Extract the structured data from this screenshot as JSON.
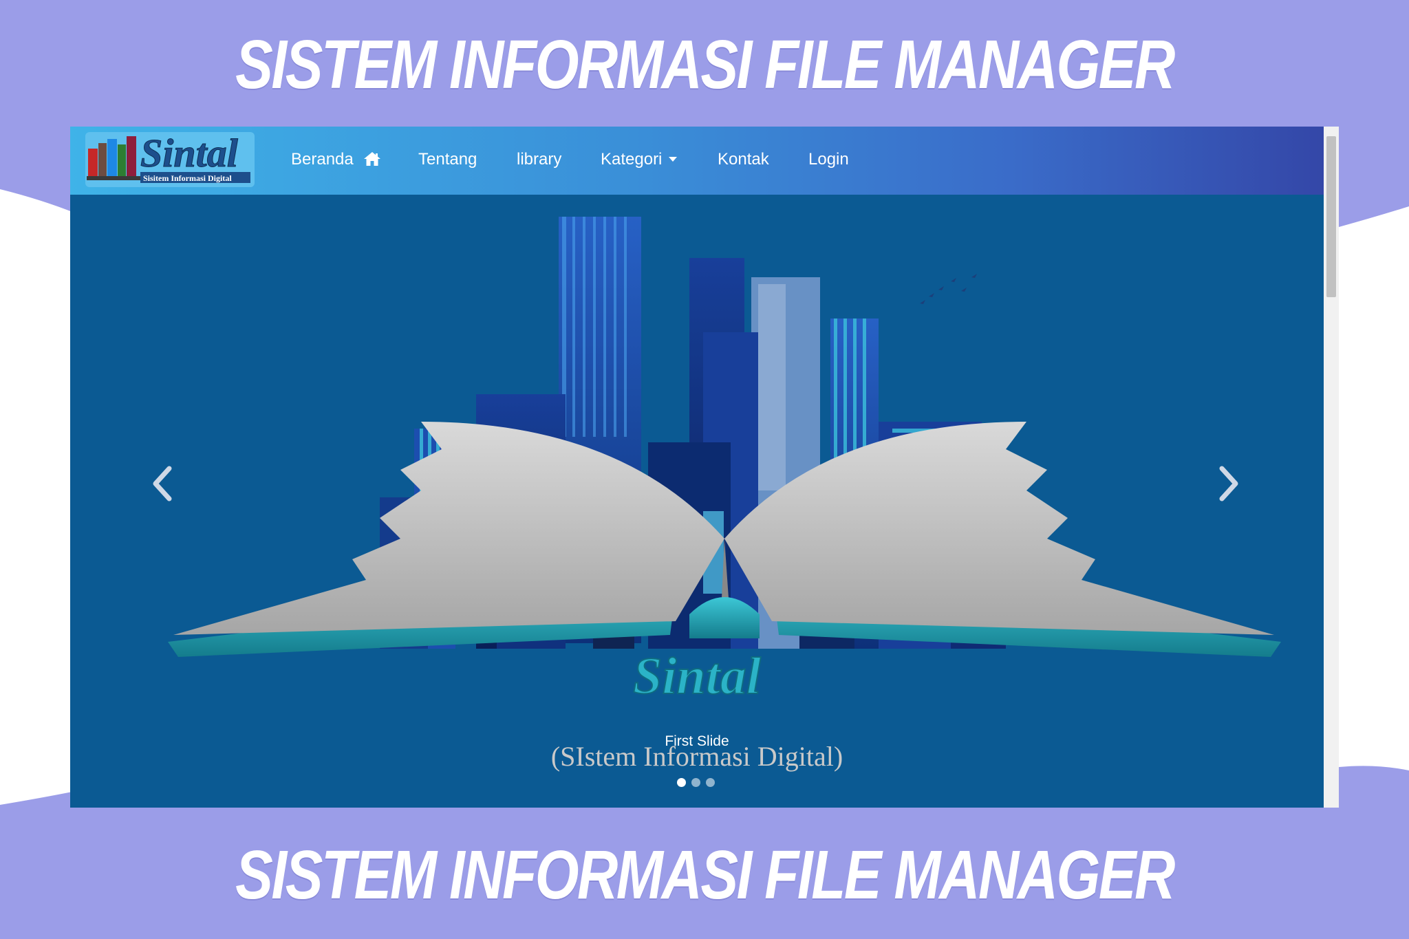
{
  "banner": {
    "title_top": "SISTEM INFORMASI FILE MANAGER",
    "title_bottom": "SISTEM INFORMASI FILE MANAGER"
  },
  "logo": {
    "name": "Sintal",
    "tagline": "Sisitem Informasi Digital"
  },
  "nav": {
    "items": [
      {
        "label": "Beranda",
        "icon": "home-icon"
      },
      {
        "label": "Tentang"
      },
      {
        "label": "library"
      },
      {
        "label": "Kategori",
        "icon": "caret-down-icon"
      },
      {
        "label": "Kontak"
      },
      {
        "label": "Login"
      }
    ]
  },
  "hero": {
    "brand": "Sintal",
    "brand_subtitle": "(SIstem Informasi Digital)",
    "caption": "First Slide",
    "slide_count": 3,
    "active_slide": 1
  },
  "colors": {
    "page_background": "#9b9de8",
    "navbar_start": "#3fb3e8",
    "navbar_end": "#3447a8",
    "hero_background": "#0b5a93"
  }
}
